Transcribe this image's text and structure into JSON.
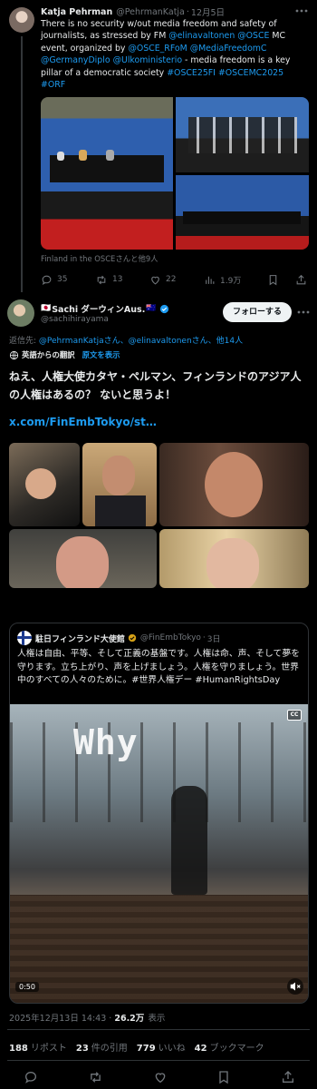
{
  "tweet1": {
    "name": "Katja Pehrman",
    "handle": "@PehrmanKatja",
    "dot": "·",
    "date": "12月5日",
    "text_parts": [
      {
        "t": "There is no security w/out media freedom and safety of journalists, as stressed by FM ",
        "link": false
      },
      {
        "t": "@elinavaltonen",
        "link": true
      },
      {
        "t": " ",
        "link": false
      },
      {
        "t": "@OSCE",
        "link": true
      },
      {
        "t": " MC event, organized by ",
        "link": false
      },
      {
        "t": "@OSCE_RFoM",
        "link": true
      },
      {
        "t": " ",
        "link": false
      },
      {
        "t": "@MediaFreedomC",
        "link": true
      },
      {
        "t": " ",
        "link": false
      },
      {
        "t": "@GermanyDiplo",
        "link": true
      },
      {
        "t": " ",
        "link": false
      },
      {
        "t": "@Ulkoministerio",
        "link": true
      },
      {
        "t": " - media freedom is a key pillar of a democratic society ",
        "link": false
      },
      {
        "t": "#OSCE25FI",
        "link": true
      },
      {
        "t": " ",
        "link": false
      },
      {
        "t": "#OSCEMC2025",
        "link": true
      },
      {
        "t": " ",
        "link": false
      },
      {
        "t": "#ORF",
        "link": true
      }
    ],
    "tagged": "Finland in the OSCEさんと他9人",
    "stats": {
      "replies": "35",
      "retweets": "13",
      "likes": "22",
      "views": "1.9万"
    }
  },
  "tweet2": {
    "flag_prefix": "🇯🇵",
    "name": "Sachi ダーウィンAus.",
    "flag_suffix": "🇦🇺",
    "handle": "@sachihirayama",
    "follow_label": "フォローする",
    "reply_prefix": "返信先: ",
    "reply_to": "@PehrmanKatjaさん、@elinavaltonenさん、他14人",
    "translated_from": "英語からの翻訳",
    "show_original": "原文を表示",
    "text": "ねえ、人権大使カタヤ・ペルマン、フィンランドのアジア人の人権はあるの？ ないと思うよ！",
    "link": "x.com/FinEmbTokyo/st…",
    "quote": {
      "name": "駐日フィンランド大使館",
      "handle": "@FinEmbTokyo",
      "dot": "·",
      "date": "3日",
      "text": "人権は自由、平等、そして正義の基盤です。人権は命、声、そして夢を守ります。立ち上がり、声を上げましょう。人権を守りましょう。世界中のすべての人々のために。#世界人権デー #HumanRightsDay",
      "video_overlay_text": "Why",
      "cc_label": "CC",
      "video_time": "0:50"
    },
    "timestamp": "2025年12月13日 14:43",
    "views_count": "26.2万",
    "views_label": "表示",
    "stats": [
      {
        "value": "188",
        "label": "リポスト"
      },
      {
        "value": "23",
        "label": "件の引用"
      },
      {
        "value": "779",
        "label": "いいね"
      },
      {
        "value": "42",
        "label": "ブックマーク"
      }
    ]
  },
  "colors": {
    "background": "#000000",
    "text": "#e7e9ea",
    "muted": "#71767b",
    "link": "#1d9bf0",
    "divider": "#2f3336",
    "verified": "#1d9bf0"
  },
  "icons": [
    "more-icon",
    "reply-icon",
    "retweet-icon",
    "like-icon",
    "views-icon",
    "bookmark-icon",
    "share-icon",
    "verified-icon",
    "translate-icon",
    "cc-icon",
    "mute-icon"
  ]
}
